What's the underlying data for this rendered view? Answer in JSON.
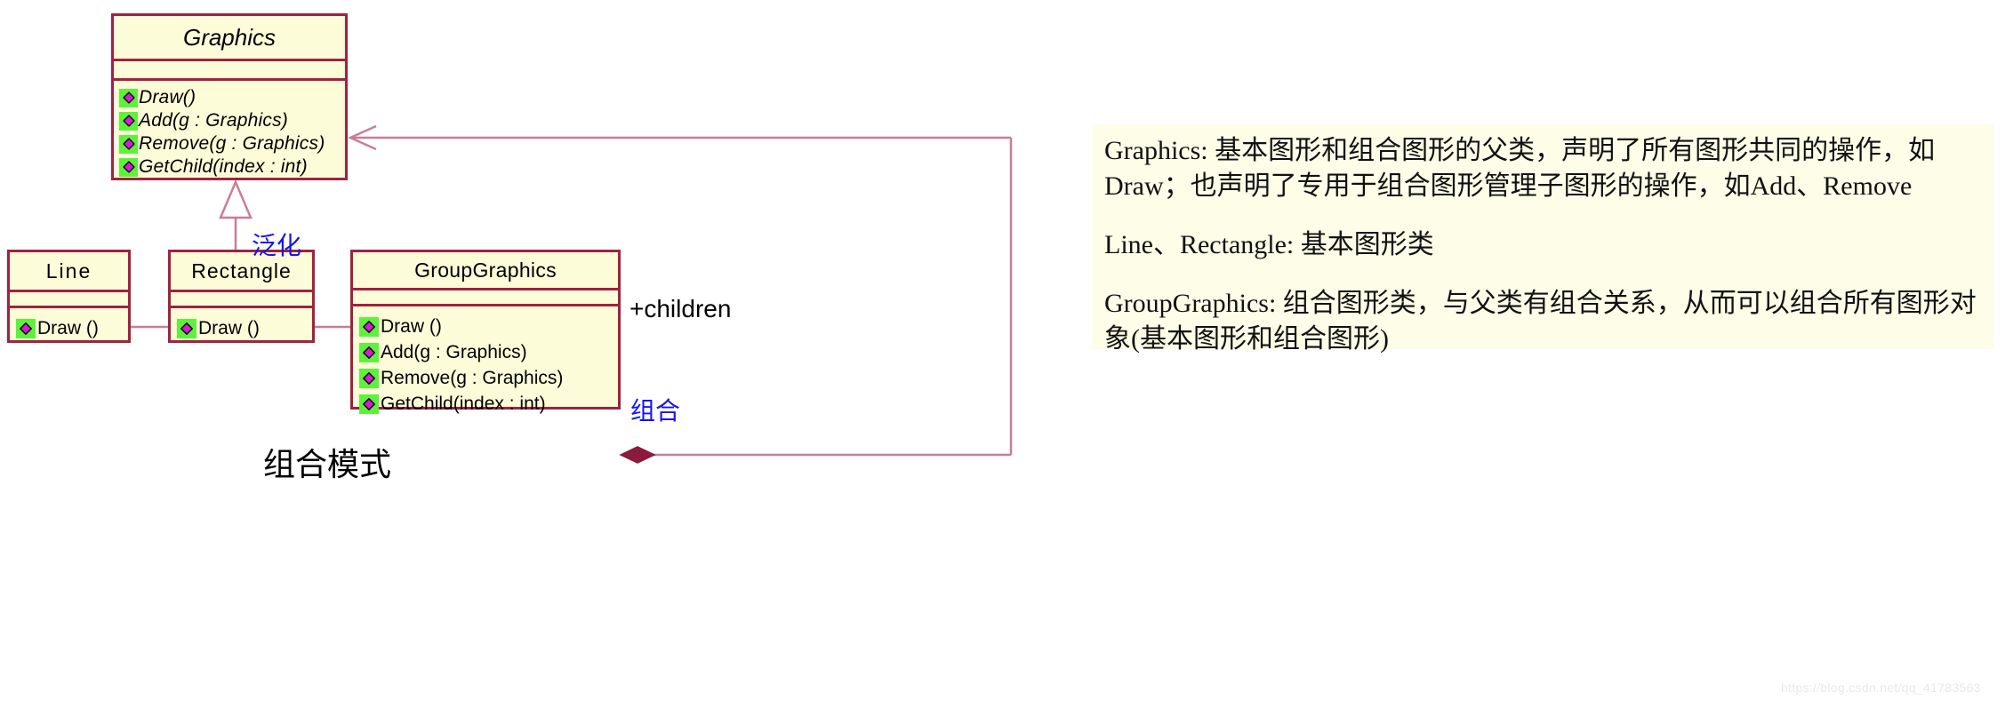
{
  "diagram": {
    "caption": "组合模式",
    "classes": [
      {
        "id": "graphics",
        "name": "Graphics",
        "abstract": true,
        "attributes": [],
        "operations": [
          "Draw()",
          "Add(g : Graphics)",
          "Remove(g : Graphics)",
          "GetChild(index : int)"
        ]
      },
      {
        "id": "line",
        "name": "Line",
        "abstract": false,
        "attributes": [],
        "operations": [
          "Draw ()"
        ]
      },
      {
        "id": "rectangle",
        "name": "Rectangle",
        "abstract": false,
        "attributes": [],
        "operations": [
          "Draw ()"
        ]
      },
      {
        "id": "groupgraphics",
        "name": "GroupGraphics",
        "abstract": false,
        "attributes": [],
        "operations": [
          "Draw ()",
          "Add(g : Graphics)",
          "Remove(g : Graphics)",
          "GetChild(index : int)"
        ]
      }
    ],
    "relations": {
      "generalization_label": "泛化",
      "composition_label": "组合",
      "composition_role": "+children"
    }
  },
  "description": {
    "paragraphs": [
      "Graphics: 基本图形和组合图形的父类，声明了所有图形共同的操作，如Draw；也声明了专用于组合图形管理子图形的操作，如Add、Remove",
      "Line、Rectangle: 基本图形类",
      "GroupGraphics: 组合图形类，与父类有组合关系，从而可以组合所有图形对象(基本图形和组合图形)"
    ]
  },
  "watermark": "https://blog.csdn.net/qq_41783563",
  "colors": {
    "class_fill": "#FDFCD8",
    "class_border": "#9E2341",
    "op_icon_bg": "#5CF23C",
    "op_icon_diamond": "#CC22CC",
    "connector": "#C97E96",
    "composition_diamond": "#8B1A3C",
    "annotation_blue": "#1414F0",
    "panel_fill": "#FDFDE8"
  }
}
